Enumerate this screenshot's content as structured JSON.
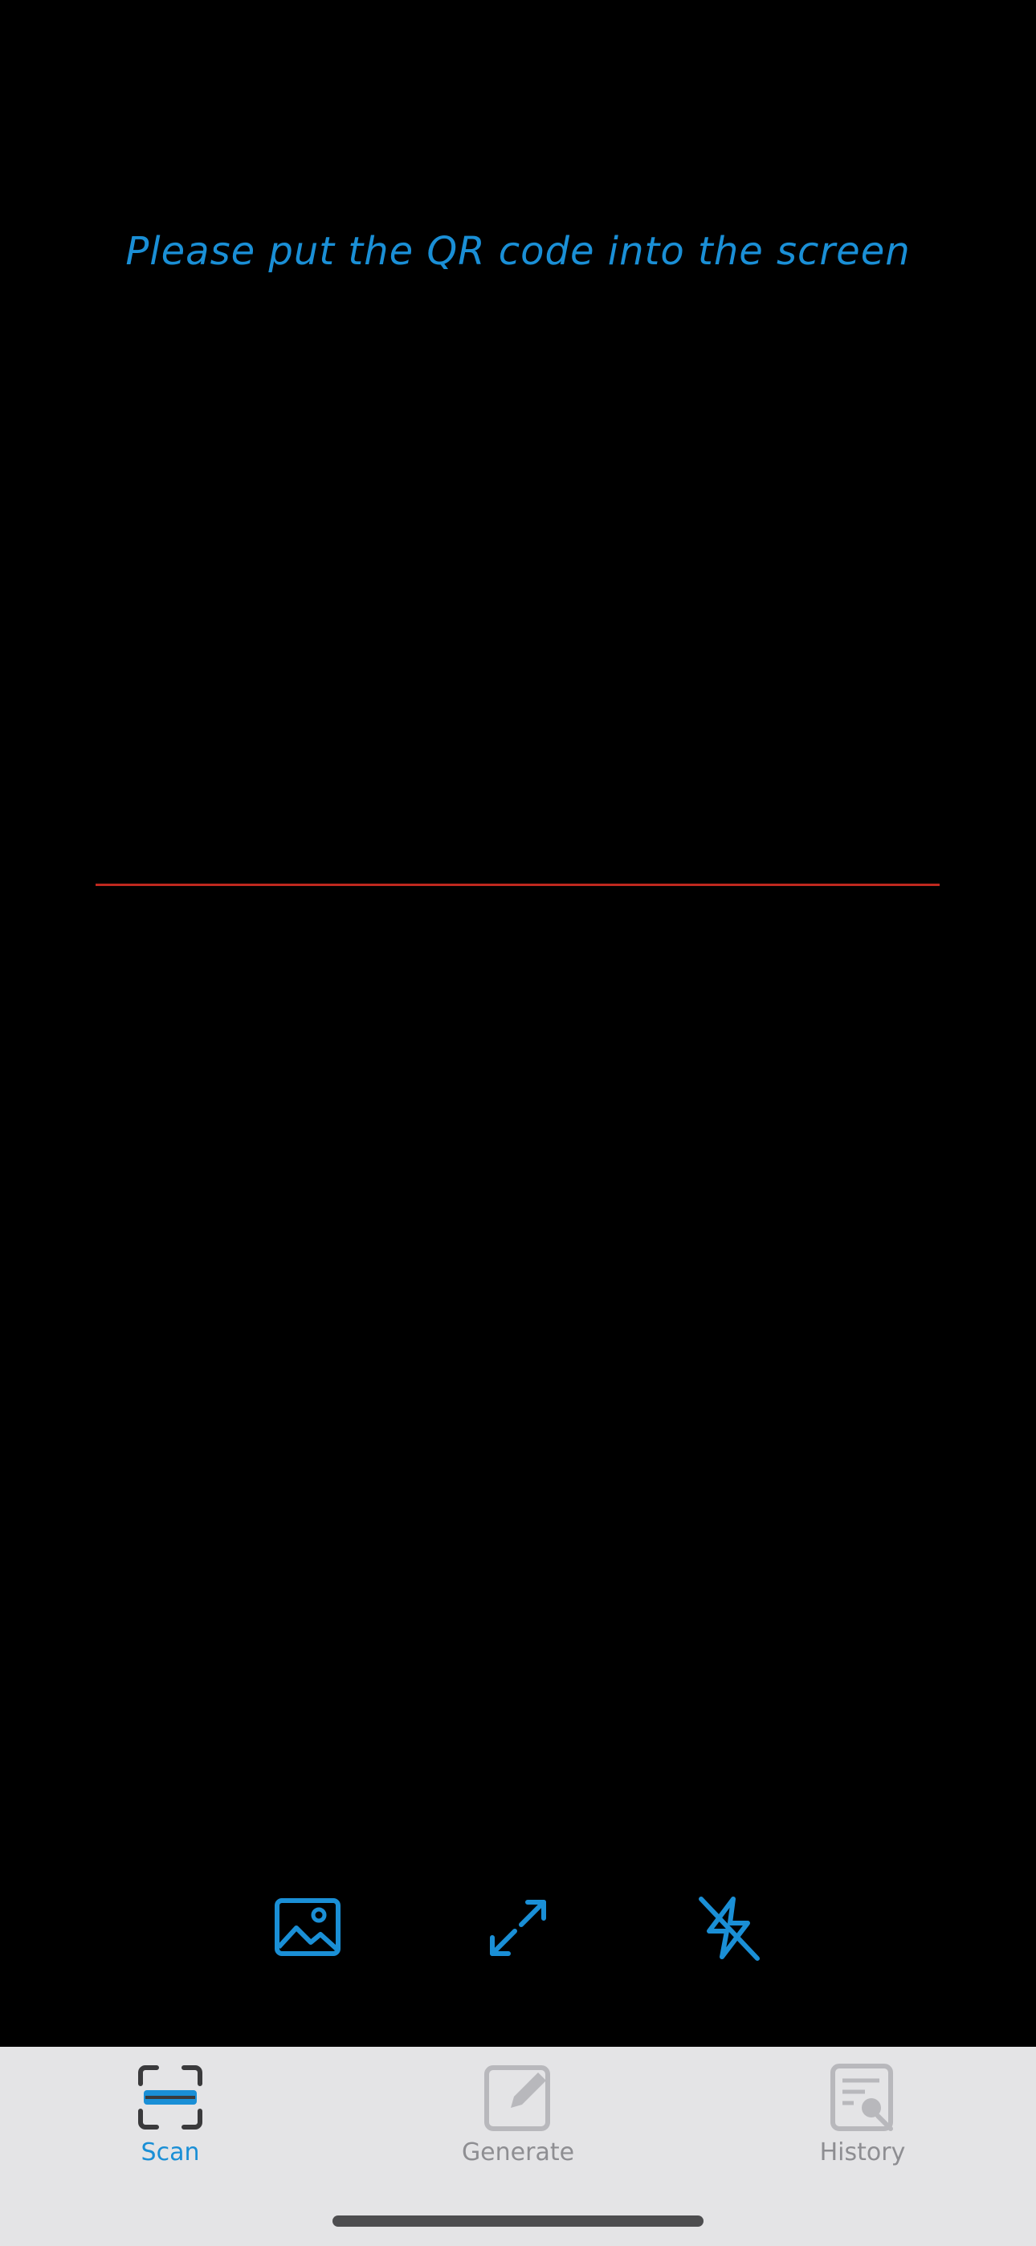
{
  "instruction": "Please put the QR code into the screen",
  "colors": {
    "accent": "#1a8fd6",
    "scan_line": "#c0291f",
    "tab_inactive": "#8e8e92",
    "tabbar_bg": "#e4e4e6"
  },
  "controls": [
    {
      "name": "gallery",
      "icon": "photo-icon"
    },
    {
      "name": "expand",
      "icon": "expand-arrows-icon"
    },
    {
      "name": "flash",
      "icon": "flash-off-icon"
    }
  ],
  "tabs": [
    {
      "label": "Scan",
      "icon": "scan-icon",
      "active": true
    },
    {
      "label": "Generate",
      "icon": "edit-square-icon",
      "active": false
    },
    {
      "label": "History",
      "icon": "document-search-icon",
      "active": false
    }
  ]
}
